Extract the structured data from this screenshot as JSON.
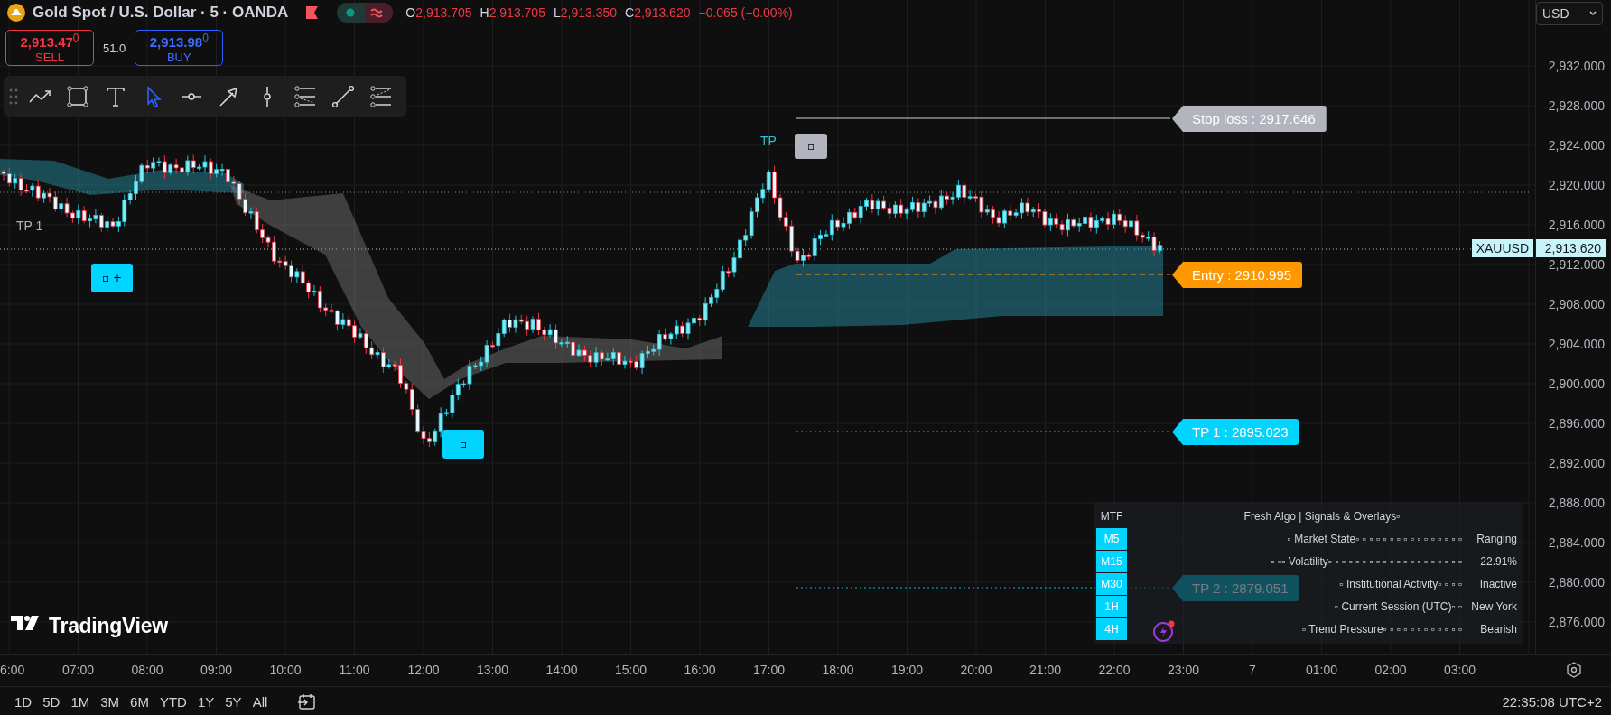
{
  "header": {
    "title": "Gold Spot / U.S. Dollar · 5 · OANDA",
    "ohlc": [
      {
        "key": "O",
        "value": "2,913.705"
      },
      {
        "key": "H",
        "value": "2,913.705"
      },
      {
        "key": "L",
        "value": "2,913.350"
      },
      {
        "key": "C",
        "value": "2,913.620"
      }
    ],
    "change": "−0.065 (−0.00%)"
  },
  "trade": {
    "sell": {
      "price": "2,913.47",
      "pip": "0",
      "label": "SELL"
    },
    "spread": "51.0",
    "buy": {
      "price": "2,913.98",
      "pip": "0",
      "label": "BUY"
    }
  },
  "drawing_tools": [
    {
      "kind": "trend",
      "selected": false
    },
    {
      "kind": "rectangle",
      "selected": false
    },
    {
      "kind": "text",
      "selected": false
    },
    {
      "kind": "cursor",
      "selected": true
    },
    {
      "kind": "horizontal",
      "selected": false
    },
    {
      "kind": "arrow",
      "selected": false
    },
    {
      "kind": "vertical",
      "selected": false
    },
    {
      "kind": "channel",
      "selected": false
    },
    {
      "kind": "line",
      "selected": false
    },
    {
      "kind": "fib",
      "selected": false
    }
  ],
  "currency": "USD",
  "price_axis": {
    "ticks": [
      "2,932.000",
      "2,928.000",
      "2,924.000",
      "2,920.000",
      "2,916.000",
      "2,912.000",
      "2,908.000",
      "2,904.000",
      "2,900.000",
      "2,896.000",
      "2,892.000",
      "2,888.000",
      "2,884.000",
      "2,880.000",
      "2,876.000"
    ],
    "symbol": "XAUUSD",
    "last_price": "2,913.620"
  },
  "chart_labels": [
    {
      "kind": "stop",
      "text": "Stop loss : 2917.646"
    },
    {
      "kind": "entry",
      "text": "Entry : 2910.995"
    },
    {
      "kind": "target",
      "text": "TP 1 : 2895.023"
    },
    {
      "kind": "target-faded",
      "text": "TP 2 : 2879.051"
    }
  ],
  "chart_marks": [
    {
      "kind": "tp-text",
      "text": "TP 1"
    },
    {
      "kind": "tp-text-signal",
      "text": "TP"
    },
    {
      "kind": "buy-signal",
      "text": "▫ +"
    },
    {
      "kind": "buy-signal",
      "text": "▫"
    },
    {
      "kind": "exit-signal",
      "text": "▫"
    }
  ],
  "signal_table": {
    "header": [
      "MTF",
      "Fresh Algo | Signals & Overlays▫"
    ],
    "rows": [
      {
        "timeframe": "M5",
        "label": "▫   Market State▫ ▫ ▫ ▫ ▫ ▫ ▫ ▫ ▫ ▫ ▫ ▫ ▫ ▫ ▫ ▫",
        "value": "Ranging"
      },
      {
        "timeframe": "M15",
        "label": "▫ ▫▫   Volatility▫ ▫ ▫ ▫ ▫ ▫ ▫ ▫ ▫ ▫ ▫ ▫ ▫ ▫ ▫ ▫ ▫ ▫ ▫ ▫",
        "value": "22.91%"
      },
      {
        "timeframe": "M30",
        "label": "▫   Institutional Activity▫ ▫ ▫ ▫",
        "value": "Inactive"
      },
      {
        "timeframe": "1H",
        "label": "▫   Current Session (UTC)▫ ▫",
        "value": "New York"
      },
      {
        "timeframe": "4H",
        "label": "▫   Trend Pressure▫ ▫ ▫ ▫ ▫ ▫ ▫ ▫ ▫ ▫ ▫ ▫",
        "value": "Bearish"
      }
    ]
  },
  "logo": "TradingView",
  "time_axis": [
    "6:00",
    "07:00",
    "08:00",
    "09:00",
    "10:00",
    "11:00",
    "12:00",
    "13:00",
    "14:00",
    "15:00",
    "16:00",
    "17:00",
    "18:00",
    "19:00",
    "20:00",
    "21:00",
    "22:00",
    "23:00",
    "7",
    "01:00",
    "02:00",
    "03:00"
  ],
  "ranges": [
    "1D",
    "5D",
    "1M",
    "3M",
    "6M",
    "YTD",
    "1Y",
    "5Y",
    "All"
  ],
  "clock": "22:35:08 UTC+2"
}
